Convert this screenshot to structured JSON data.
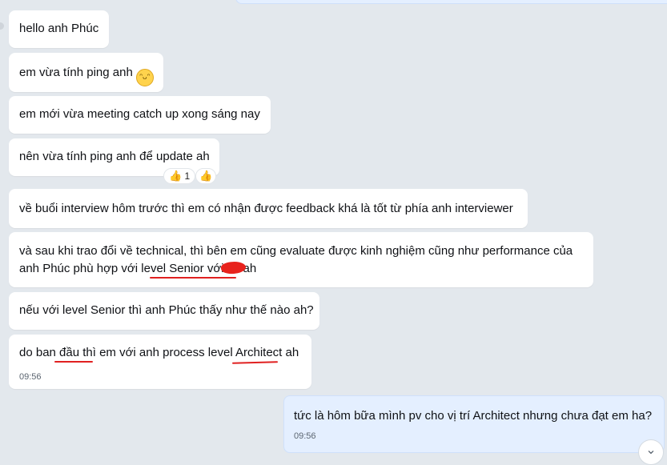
{
  "messages": [
    {
      "text": "hello anh Phúc"
    },
    {
      "text": "em vừa tính ping anh",
      "emoji_icon": "grinning-face-emoji"
    },
    {
      "text": "em mới vừa meeting catch up xong sáng nay"
    },
    {
      "text": "nên vừa tính ping anh để update ah",
      "reactions": [
        {
          "icon": "thumbs-up",
          "count": "1"
        },
        {
          "icon": "thumbs-up",
          "count": ""
        }
      ]
    },
    {
      "text": "về buổi interview hôm trước thì em có nhận được feedback khá là tốt từ phía anh interviewer"
    },
    {
      "line1": "và sau khi trao đổi về technical, thì bên em cũng evaluate được kinh nghiệm cũng như performance của",
      "line2": "anh Phúc phù hợp với level Senior với",
      "line2_end": "ah"
    },
    {
      "text": "nếu với level Senior thì anh Phúc thấy như thế nào ah?"
    },
    {
      "text": "do ban đầu thì em với anh process level Architect ah",
      "time": "09:56"
    }
  ],
  "sent_message": {
    "text": "tức là hôm bữa mình pv cho vị trí Architect nhưng chưa đạt em ha?",
    "time": "09:56"
  },
  "colors": {
    "background": "#e3e8ed",
    "incoming_bubble": "#ffffff",
    "outgoing_bubble": "#e4efff",
    "annotation": "#e02020"
  },
  "scroll_down_icon": "chevron-down-icon"
}
